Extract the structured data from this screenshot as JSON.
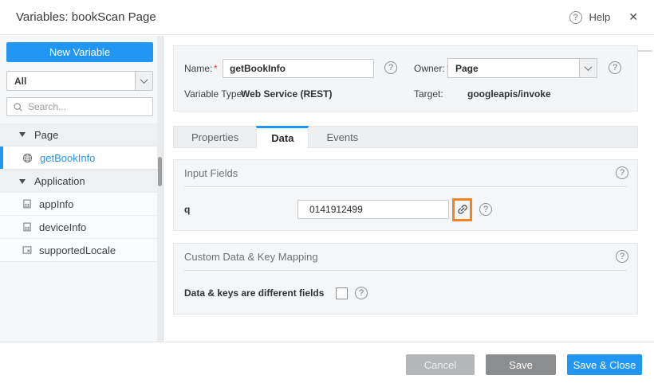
{
  "colors": {
    "accent_blue": "#2196f3",
    "highlight_orange": "#f5821f",
    "required_red": "#e53935"
  },
  "icons": {
    "help": "?",
    "close": "✕"
  },
  "header": {
    "title": "Variables: bookScan Page",
    "help_label": "Help"
  },
  "sidebar": {
    "new_variable_button": "New Variable",
    "filter_value": "All",
    "search_placeholder": "Search...",
    "tree": [
      {
        "type": "group",
        "label": "Page"
      },
      {
        "type": "item",
        "label": "getBookInfo",
        "icon": "web-service",
        "selected": true
      },
      {
        "type": "group",
        "label": "Application"
      },
      {
        "type": "item",
        "label": "appInfo",
        "icon": "app-data"
      },
      {
        "type": "item",
        "label": "deviceInfo",
        "icon": "app-data"
      },
      {
        "type": "item",
        "label": "supportedLocale",
        "icon": "locale"
      }
    ]
  },
  "form": {
    "name_label": "Name:",
    "required_mark": "*",
    "name_value": "getBookInfo",
    "owner_label": "Owner:",
    "owner_value": "Page",
    "variable_type_label": "Variable Type:",
    "variable_type_value": "Web Service (REST)",
    "target_label": "Target:",
    "target_value": "googleapis/invoke"
  },
  "tabs": [
    {
      "label": "Properties",
      "active": false
    },
    {
      "label": "Data",
      "active": true
    },
    {
      "label": "Events",
      "active": false
    }
  ],
  "input_fields": {
    "title": "Input Fields",
    "rows": [
      {
        "key": "q",
        "value": "0141912499"
      }
    ]
  },
  "custom_mapping": {
    "title": "Custom Data & Key Mapping",
    "checkbox_label": "Data & keys are different fields",
    "checked": false
  },
  "footer": {
    "cancel_label": "Cancel",
    "save_label": "Save",
    "save_close_label": "Save & Close"
  }
}
